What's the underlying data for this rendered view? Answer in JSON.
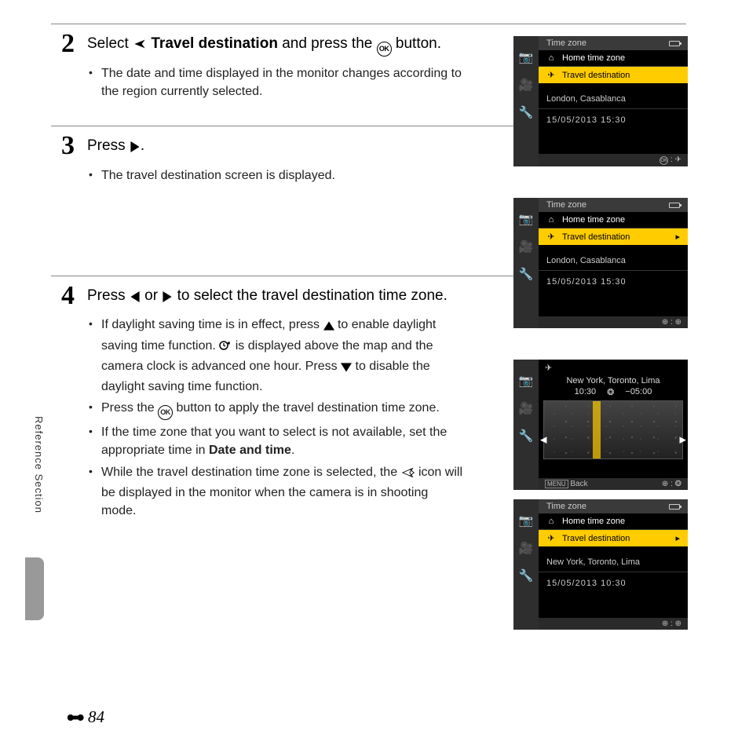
{
  "sideLabel": "Reference Section",
  "pageNumber": "84",
  "steps": {
    "s2": {
      "num": "2",
      "h_pre": "Select ",
      "h_bold": " Travel destination",
      "h_mid": " and press the ",
      "h_post": " button.",
      "b1": "The date and time displayed in the monitor changes according to the region currently selected."
    },
    "s3": {
      "num": "3",
      "h_pre": "Press ",
      "h_post": ".",
      "b1": "The travel destination screen is displayed."
    },
    "s4": {
      "num": "4",
      "h_pre": "Press ",
      "h_mid": " or ",
      "h_post": " to select the travel destination time zone.",
      "b1a": "If daylight saving time is in effect, press ",
      "b1b": " to enable daylight saving time function. ",
      "b1c": " is displayed above the map and the camera clock is advanced one hour. Press ",
      "b1d": " to disable the daylight saving time function.",
      "b2a": "Press the ",
      "b2b": " button to apply the travel destination time zone.",
      "b3a": "If the time zone that you want to select is not available, set the appropriate time in ",
      "b3b": "Date and time",
      "b3c": ".",
      "b4a": "While the travel destination time zone is selected, the ",
      "b4b": " icon will be displayed in the monitor when the camera is in shooting mode."
    }
  },
  "lcd": {
    "title": "Time zone",
    "home": "Home time zone",
    "travel": "Travel destination",
    "loc1": "London, Casablanca",
    "date1": "15/05/2013  15:30",
    "loc2": "New York, Toronto, Lima",
    "date2": "15/05/2013  10:30",
    "mapTime1": "10:30",
    "mapTime2": "−05:00",
    "back": "Back",
    "menuFooter": "MENU"
  }
}
